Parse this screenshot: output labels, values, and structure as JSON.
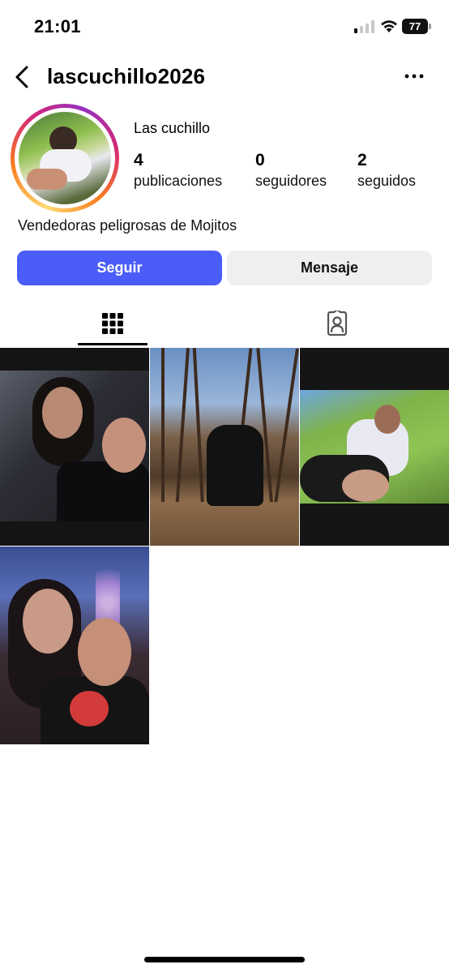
{
  "status_bar": {
    "time": "21:01",
    "battery": "77"
  },
  "header": {
    "username": "lascuchillo2026"
  },
  "profile": {
    "display_name": "Las cuchillo",
    "bio": "Vendedoras peligrosas de Mojitos",
    "stats": {
      "posts_count": "4",
      "posts_label": "publicaciones",
      "followers_count": "0",
      "followers_label": "seguidores",
      "following_count": "2",
      "following_label": "seguidos"
    }
  },
  "actions": {
    "follow_label": "Seguir",
    "message_label": "Mensaje"
  },
  "tabs": [
    {
      "icon": "grid-icon",
      "active": true
    },
    {
      "icon": "tagged-icon",
      "active": false
    }
  ],
  "posts": [
    {
      "icon": "photo"
    },
    {
      "icon": "photo"
    },
    {
      "icon": "photo"
    },
    {
      "icon": "photo"
    }
  ],
  "colors": {
    "follow_button": "#4a5df9",
    "message_button": "#efeff2"
  }
}
